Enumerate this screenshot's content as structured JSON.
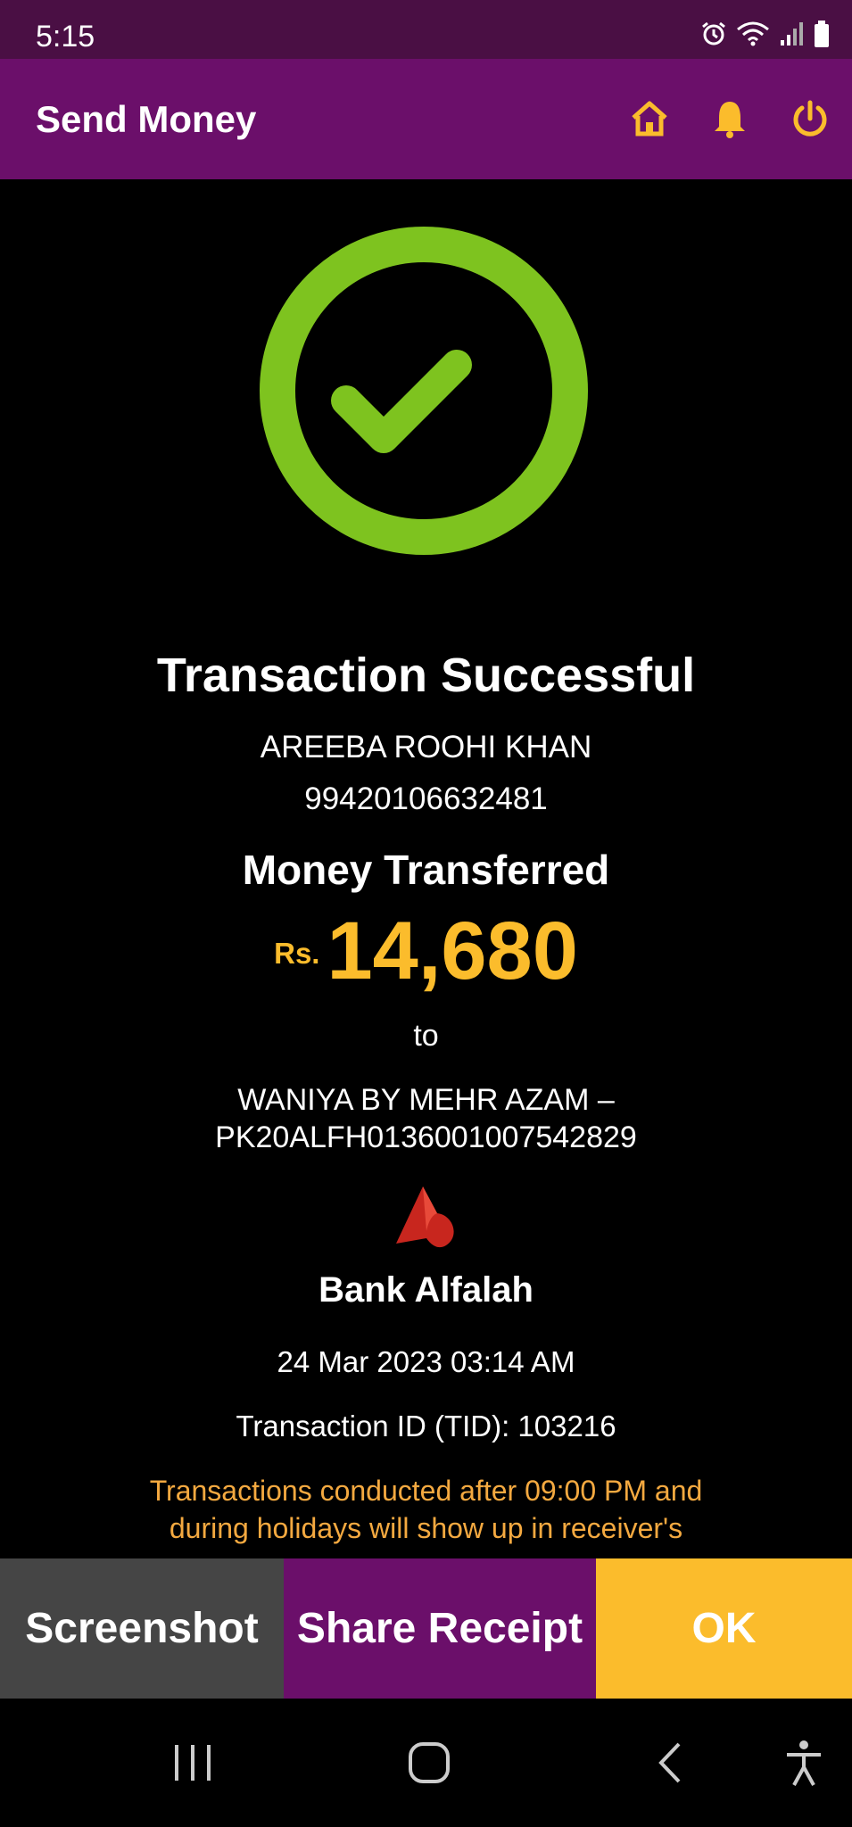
{
  "status_bar": {
    "time": "5:15",
    "icons": [
      "alarm-icon",
      "wifi-icon",
      "signal-icon",
      "battery-icon"
    ]
  },
  "app_bar": {
    "title": "Send Money",
    "actions": [
      "home-icon",
      "bell-icon",
      "power-icon"
    ],
    "accent_color": "#fbbc2c",
    "bg_color": "#6b0f6a"
  },
  "success_icon": {
    "name": "check-circle-icon",
    "color": "#7ec31f"
  },
  "receipt": {
    "headline": "Transaction Successful",
    "sender_name": "AREEBA ROOHI KHAN",
    "sender_account": "99420106632481",
    "money_label": "Money Transferred",
    "currency": "Rs.",
    "amount": "14,680",
    "to_word": "to",
    "destination_line1": "WANIYA BY MEHR AZAM –",
    "destination_line2": "PK20ALFH0136001007542829",
    "bank_name": "Bank Alfalah",
    "datetime": "24 Mar 2023 03:14 AM",
    "tid": "Transaction ID (TID): 103216",
    "notice_line1": "Transactions conducted after 09:00 PM and",
    "notice_line2": "during holidays will show up in receiver's"
  },
  "buttons": {
    "screenshot": "Screenshot",
    "share": "Share Receipt",
    "ok": "OK"
  },
  "nav": [
    "recent-apps-icon",
    "home-nav-icon",
    "back-icon",
    "accessibility-icon"
  ]
}
